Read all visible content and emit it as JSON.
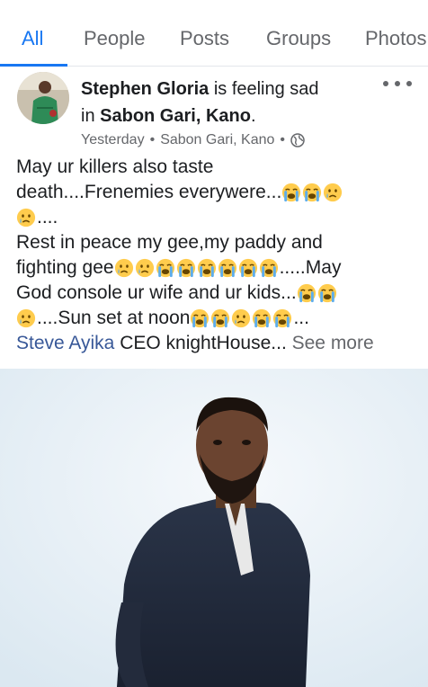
{
  "tabs": [
    "All",
    "People",
    "Posts",
    "Groups",
    "Photos"
  ],
  "post": {
    "author": "Stephen Gloria",
    "feeling": "is feeling sad",
    "in_word": "in",
    "location": "Sabon Gari, Kano",
    "period": ".",
    "meta": {
      "time": "Yesterday",
      "location": "Sabon Gari, Kano",
      "dot": "•"
    },
    "text": {
      "line1": "May ur killers also taste",
      "line2": "death....Frenemies everywere...",
      "line3": "....",
      "line4": "Rest in peace my gee,my paddy and",
      "line5a": "fighting gee",
      "line5b": ".....May",
      "line6": "God console ur wife and ur kids...",
      "line7a": "....Sun set at noon",
      "line7b": "...",
      "tag": "Steve Ayika",
      "after_tag": " CEO knightHouse...",
      "see_more": " See more"
    }
  },
  "icons": {
    "crying": "loudly-crying-face",
    "sad": "crying-face",
    "globe": "globe-icon",
    "more": "more-options-icon"
  },
  "colors": {
    "accent": "#1877f2",
    "link": "#385898",
    "muted": "#65676b",
    "text": "#1c1e21"
  }
}
